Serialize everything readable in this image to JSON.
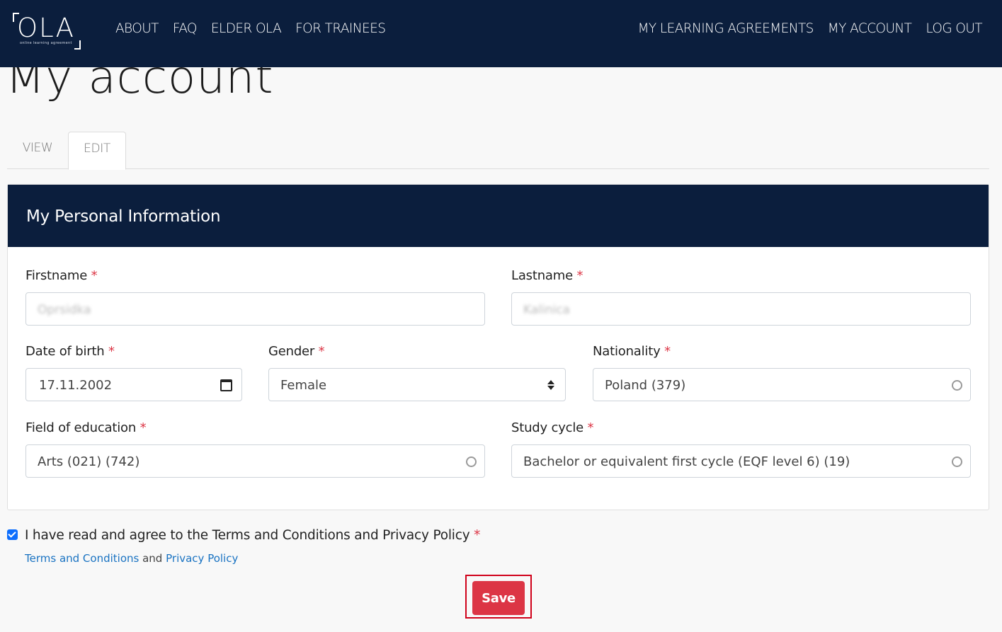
{
  "nav": {
    "logo_text": "OLA",
    "logo_subtitle": "online learning agreement",
    "left_links": [
      "ABOUT",
      "FAQ",
      "ELDER OLA",
      "FOR TRAINEES"
    ],
    "right_links": [
      "MY LEARNING AGREEMENTS",
      "MY ACCOUNT",
      "LOG OUT"
    ]
  },
  "page": {
    "title": "My account"
  },
  "tabs": [
    "VIEW",
    "EDIT"
  ],
  "active_tab": "EDIT",
  "card": {
    "title": "My Personal Information",
    "required_marker": "*",
    "fields": {
      "firstname": {
        "label": "Firstname",
        "value": "Oprsidka"
      },
      "lastname": {
        "label": "Lastname",
        "value": "Kalinica"
      },
      "dob": {
        "label": "Date of birth",
        "value": "17.11.2002"
      },
      "gender": {
        "label": "Gender",
        "value": "Female"
      },
      "nationality": {
        "label": "Nationality",
        "value": "Poland (379)"
      },
      "field_of_education": {
        "label": "Field of education",
        "value": "Arts (021) (742)"
      },
      "study_cycle": {
        "label": "Study cycle",
        "value": "Bachelor or equivalent first cycle (EQF level 6) (19)"
      }
    }
  },
  "agreement": {
    "text": "I have read and agree to the Terms and Conditions and Privacy Policy",
    "checked": true,
    "terms_link": "Terms and Conditions",
    "and": "and",
    "privacy_link": "Privacy Policy"
  },
  "save_label": "Save",
  "colors": {
    "navy": "#0b1e3d",
    "danger": "#dc3545",
    "link": "#1a73c2"
  },
  "icons": [
    "calendar-icon",
    "select-arrows-icon",
    "autocomplete-circle-icon",
    "checkmark-icon"
  ]
}
